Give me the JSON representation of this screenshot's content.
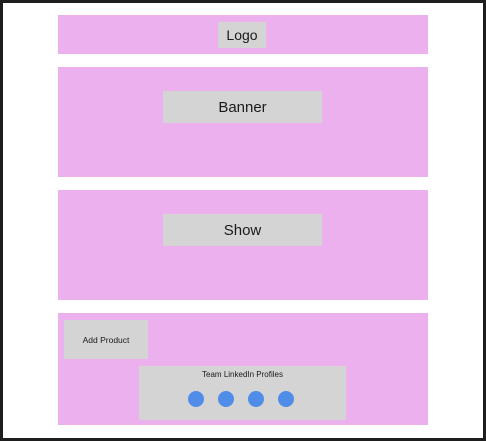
{
  "wireframe": {
    "logo_label": "Logo",
    "banner_label": "Banner",
    "show_label": "Show",
    "add_product_label": "Add Product",
    "team_linkedin_title": "Team LinkedIn Profiles",
    "profile_count": 4
  },
  "colors": {
    "section_fill": "#ecb0ee",
    "placeholder_fill": "#d4d4d4",
    "profile_dot": "#4f8de9",
    "frame": "#1e1e1e"
  }
}
